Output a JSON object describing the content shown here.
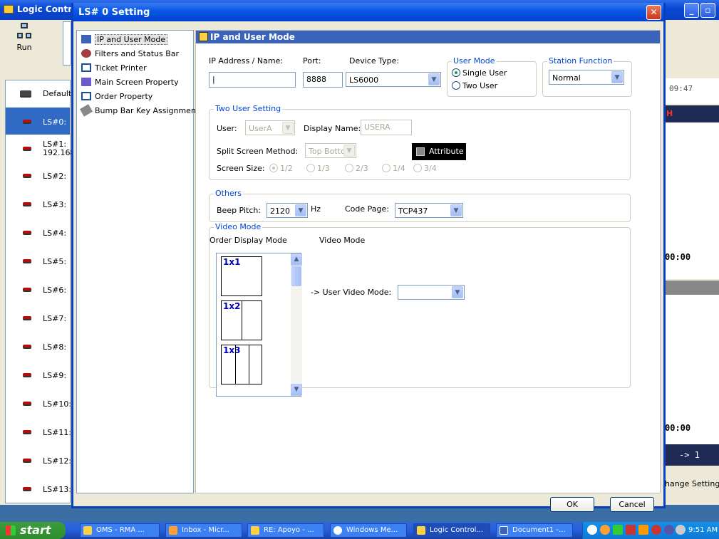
{
  "bg_window": {
    "title": "Logic Contr",
    "run_label": "Run",
    "list_items": [
      {
        "label": "Default"
      },
      {
        "label": "LS#0:",
        "selected": true
      },
      {
        "label": "LS#1:",
        "sub": "192.168"
      },
      {
        "label": "LS#2:"
      },
      {
        "label": "LS#3:"
      },
      {
        "label": "LS#4:"
      },
      {
        "label": "LS#5:"
      },
      {
        "label": "LS#6:"
      },
      {
        "label": "LS#7:"
      },
      {
        "label": "LS#8:"
      },
      {
        "label": "LS#9:"
      },
      {
        "label": "LS#10:"
      },
      {
        "label": "LS#11:"
      },
      {
        "label": "LS#12:"
      },
      {
        "label": "LS#13:"
      }
    ],
    "right_panel": {
      "time": "09:47",
      "h": "H",
      "timer1": "00:00",
      "timer2": "00:00",
      "arrow": "-> 1",
      "change_setting": "hange Setting"
    }
  },
  "dialog": {
    "title": "LS# 0 Setting",
    "nav": [
      {
        "label": "IP and User Mode",
        "icon": "network-icon",
        "selected": true
      },
      {
        "label": "Filters and Status Bar",
        "icon": "filter-icon"
      },
      {
        "label": "Ticket Printer",
        "icon": "printer-icon"
      },
      {
        "label": "Main Screen Property",
        "icon": "monitor-icon"
      },
      {
        "label": "Order Property",
        "icon": "order-icon"
      },
      {
        "label": "Bump Bar Key Assignment",
        "icon": "keyboard-icon"
      }
    ],
    "header": "IP and User Mode",
    "ip": {
      "ip_label": "IP Address / Name:",
      "ip_value": "|",
      "port_label": "Port:",
      "port_value": "8888",
      "device_label": "Device Type:",
      "device_value": "LS6000"
    },
    "user_mode": {
      "title": "User Mode",
      "single": "Single User",
      "two": "Two User",
      "selected": "single"
    },
    "station": {
      "title": "Station Function",
      "value": "Normal"
    },
    "two_user": {
      "title": "Two User Setting",
      "user_label": "User:",
      "user_value": "UserA",
      "display_label": "Display Name:",
      "display_value": "USERA",
      "attr_label": "Attribute",
      "split_label": "Split Screen Method:",
      "split_value": "Top Botto",
      "size_label": "Screen Size:",
      "sizes": [
        "1/2",
        "1/3",
        "2/3",
        "1/4",
        "3/4"
      ]
    },
    "others": {
      "title": "Others",
      "beep_label": "Beep Pitch:",
      "beep_value": "2120",
      "hz": "Hz",
      "code_label": "Code Page:",
      "code_value": "TCP437"
    },
    "video": {
      "title": "Video Mode",
      "order_label": "Order Display Mode",
      "video_label": "Video Mode",
      "tiles": [
        "1x1",
        "1x2",
        "1x3"
      ],
      "user_video_label": "-> User Video Mode:",
      "user_video_value": ""
    },
    "ok": "OK",
    "cancel": "Cancel"
  },
  "taskbar": {
    "start": "start",
    "tasks": [
      "OMS - RMA ...",
      "Inbox - Micr...",
      "RE: Apoyo - ...",
      "Windows Me...",
      "Logic Control...",
      "Document1 -..."
    ],
    "clock": "9:51 AM"
  }
}
